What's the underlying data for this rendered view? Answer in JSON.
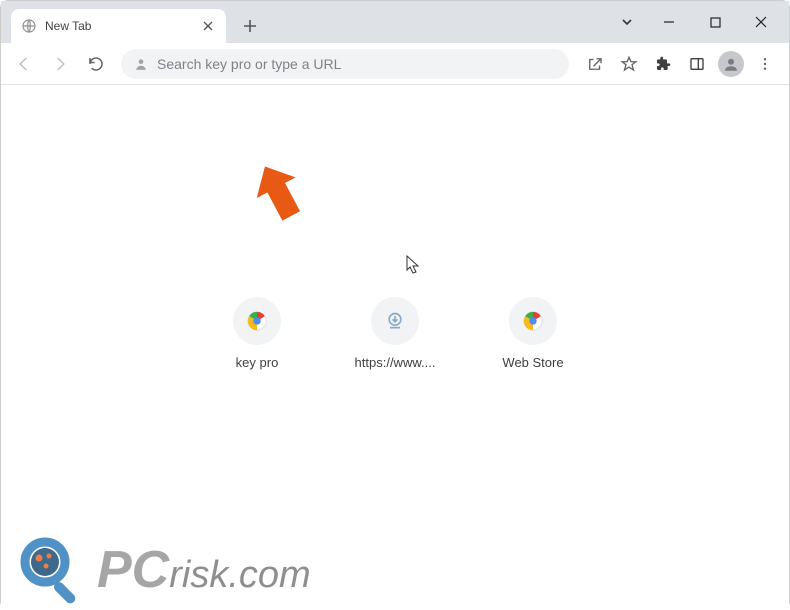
{
  "tab": {
    "title": "New Tab"
  },
  "omnibox": {
    "placeholder": "Search key pro or type a URL"
  },
  "shortcuts": [
    {
      "label": "key pro",
      "icon": "chrome"
    },
    {
      "label": "https://www....",
      "icon": "download"
    },
    {
      "label": "Web Store",
      "icon": "chrome"
    }
  ],
  "watermark": {
    "brand": "PC",
    "domain": "risk.com"
  }
}
